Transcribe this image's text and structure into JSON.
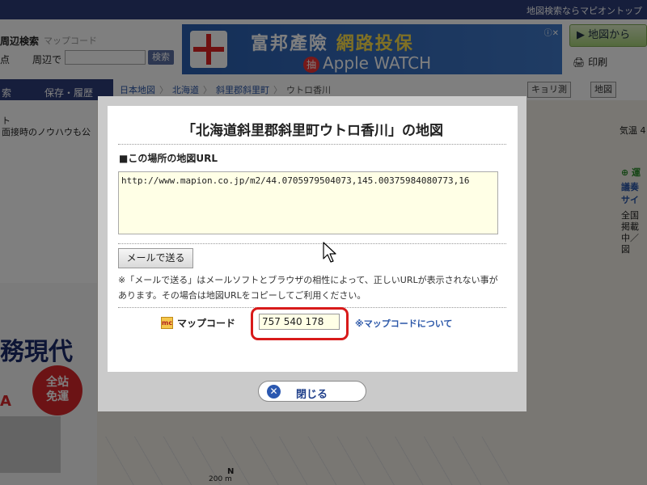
{
  "background": {
    "topbar_text": "地図検索ならマピオントップ",
    "search": {
      "tab_active": "周辺検索",
      "tab_other": "マップコード",
      "point_label": "点",
      "near_label": "周辺で",
      "search_button": "検索"
    },
    "ad": {
      "line1_a": "富邦產險",
      "line1_b": "網路投保",
      "lottery_badge": "抽",
      "line2": "Apple WATCH",
      "close_glyph": "ⓘ✕"
    },
    "right": {
      "map_button": "地図から",
      "print_link": "印刷",
      "weather": "気温 4",
      "green_link": "運",
      "link_a1": "議奏",
      "link_a2": "サイ",
      "text_b1": "全国",
      "text_b2": "掲載",
      "text_b3": "中／図"
    },
    "nav": {
      "item1": "索",
      "item2": "保存・履歴"
    },
    "breadcrumb": [
      "日本地図",
      "北海道",
      "斜里郡斜里町",
      "ウトロ香川"
    ],
    "tools": {
      "distance": "キョリ測",
      "map": "地図"
    },
    "left": {
      "text1": "ト",
      "text2": "面接時のノウハウも公",
      "ad_title": "務現代",
      "ad_badge_1": "全站",
      "ad_badge_2": "免運",
      "ad_red": "A"
    },
    "map": {
      "scale": "200 m",
      "compass": "N"
    }
  },
  "modal": {
    "title": "「北海道斜里郡斜里町ウトロ香川」の地図",
    "url_heading": "■この場所の地図URL",
    "url_value": "http://www.mapion.co.jp/m2/44.0705979504073,145.00375984080773,16",
    "mail_button": "メールで送る",
    "note": "※「メールで送る」はメールソフトとブラウザの相性によって、正しいURLが表示されない事があります。その場合は地図URLをコピーしてご利用ください。",
    "mapcode_icon": "mc",
    "mapcode_label": "マップコード",
    "mapcode_value": "757 540 178",
    "mapcode_link": "※マップコードについて",
    "close_button": "閉じる",
    "close_icon_glyph": "✕"
  },
  "colors": {
    "header_navy": "#2c3c78",
    "link_blue": "#2a56a8",
    "highlight_red": "#d81a1a",
    "textarea_bg": "#ffffe6"
  }
}
